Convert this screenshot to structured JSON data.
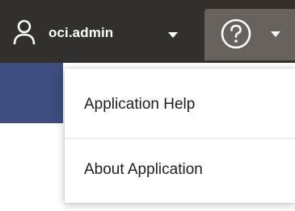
{
  "header": {
    "user": {
      "name": "oci.admin",
      "icon": "user-icon"
    },
    "help_button": {
      "icon": "question-circle-icon",
      "caret_icon": "chevron-down-icon"
    }
  },
  "help_menu": {
    "items": [
      {
        "label": "Application Help"
      },
      {
        "label": "About Application"
      }
    ]
  },
  "colors": {
    "header_bg": "#332f2c",
    "help_button_bg": "#67625e",
    "accent_strip": "#3c4d7e"
  }
}
